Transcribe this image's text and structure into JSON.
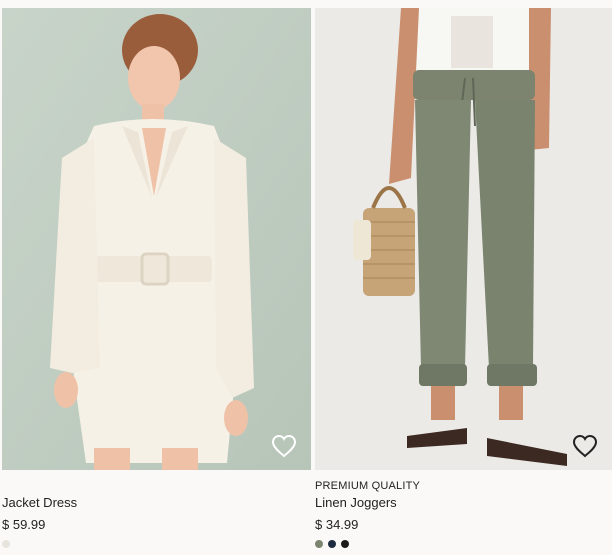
{
  "products": [
    {
      "badge": "",
      "title": "Jacket Dress",
      "price": "$ 59.99",
      "image_icon": "product-photo-jacket-dress",
      "swatches": [
        "#e7e4de"
      ]
    },
    {
      "badge": "PREMIUM QUALITY",
      "title": "Linen Joggers",
      "price": "$ 34.99",
      "image_icon": "product-photo-linen-joggers",
      "swatches": [
        "#7c8470",
        "#1d2a3f",
        "#1b1b1b"
      ]
    }
  ],
  "favorite_icon": "heart-outline-icon"
}
